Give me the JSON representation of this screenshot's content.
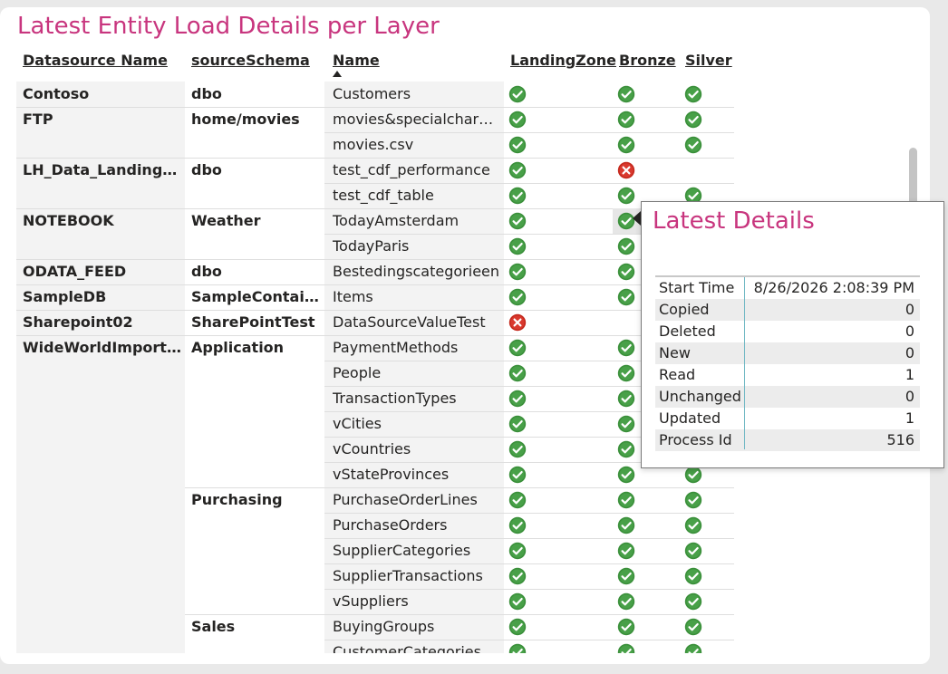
{
  "title": "Latest Entity Load Details per Layer",
  "columns": {
    "datasource": "Datasource Name",
    "schema": "sourceSchema",
    "name": "Name",
    "landing": "LandingZone",
    "bronze": "Bronze",
    "silver": "Silver"
  },
  "colors": {
    "accent": "#c8357e",
    "ok": "#3a8f3a",
    "fail": "#d9392e"
  },
  "rows": [
    {
      "ds": "Contoso",
      "schema": "dbo",
      "name": "Customers",
      "landing": "ok",
      "bronze": "ok",
      "silver": "ok"
    },
    {
      "ds": "FTP",
      "schema": "home/movies",
      "name": "movies&specialchara…",
      "landing": "ok",
      "bronze": "ok",
      "silver": "ok"
    },
    {
      "ds": "",
      "schema": "",
      "name": "movies.csv",
      "landing": "ok",
      "bronze": "ok",
      "silver": "ok"
    },
    {
      "ds": "LH_Data_Landingz…",
      "schema": "dbo",
      "name": "test_cdf_performance",
      "landing": "ok",
      "bronze": "fail",
      "silver": ""
    },
    {
      "ds": "",
      "schema": "",
      "name": "test_cdf_table",
      "landing": "ok",
      "bronze": "ok",
      "silver": "ok"
    },
    {
      "ds": "NOTEBOOK",
      "schema": "Weather",
      "name": "TodayAmsterdam",
      "landing": "ok",
      "bronze": "ok",
      "silver": "ok"
    },
    {
      "ds": "",
      "schema": "",
      "name": "TodayParis",
      "landing": "ok",
      "bronze": "ok",
      "silver": "ok"
    },
    {
      "ds": "ODATA_FEED",
      "schema": "dbo",
      "name": "Bestedingscategorieen",
      "landing": "ok",
      "bronze": "ok",
      "silver": "ok"
    },
    {
      "ds": "SampleDB",
      "schema": "SampleContainer",
      "name": "Items",
      "landing": "ok",
      "bronze": "ok",
      "silver": "ok"
    },
    {
      "ds": "Sharepoint02",
      "schema": "SharePointTest",
      "name": "DataSourceValueTest",
      "landing": "fail",
      "bronze": "",
      "silver": ""
    },
    {
      "ds": "WideWorldImporters",
      "schema": "Application",
      "name": "PaymentMethods",
      "landing": "ok",
      "bronze": "ok",
      "silver": "ok"
    },
    {
      "ds": "",
      "schema": "",
      "name": "People",
      "landing": "ok",
      "bronze": "ok",
      "silver": "ok"
    },
    {
      "ds": "",
      "schema": "",
      "name": "TransactionTypes",
      "landing": "ok",
      "bronze": "ok",
      "silver": "ok"
    },
    {
      "ds": "",
      "schema": "",
      "name": "vCities",
      "landing": "ok",
      "bronze": "ok",
      "silver": "ok"
    },
    {
      "ds": "",
      "schema": "",
      "name": "vCountries",
      "landing": "ok",
      "bronze": "ok",
      "silver": "ok"
    },
    {
      "ds": "",
      "schema": "",
      "name": "vStateProvinces",
      "landing": "ok",
      "bronze": "ok",
      "silver": "ok"
    },
    {
      "ds": "",
      "schema": "Purchasing",
      "name": "PurchaseOrderLines",
      "landing": "ok",
      "bronze": "ok",
      "silver": "ok"
    },
    {
      "ds": "",
      "schema": "",
      "name": "PurchaseOrders",
      "landing": "ok",
      "bronze": "ok",
      "silver": "ok"
    },
    {
      "ds": "",
      "schema": "",
      "name": "SupplierCategories",
      "landing": "ok",
      "bronze": "ok",
      "silver": "ok"
    },
    {
      "ds": "",
      "schema": "",
      "name": "SupplierTransactions",
      "landing": "ok",
      "bronze": "ok",
      "silver": "ok"
    },
    {
      "ds": "",
      "schema": "",
      "name": "vSuppliers",
      "landing": "ok",
      "bronze": "ok",
      "silver": "ok"
    },
    {
      "ds": "",
      "schema": "Sales",
      "name": "BuyingGroups",
      "landing": "ok",
      "bronze": "ok",
      "silver": "ok"
    },
    {
      "ds": "",
      "schema": "",
      "name": "CustomerCategories",
      "landing": "ok",
      "bronze": "ok",
      "silver": "ok"
    }
  ],
  "tooltip": {
    "title": "Latest Details",
    "rows": [
      {
        "k": "Start Time",
        "v": "8/26/2026 2:08:39 PM"
      },
      {
        "k": "Copied",
        "v": "0"
      },
      {
        "k": "Deleted",
        "v": "0"
      },
      {
        "k": "New",
        "v": "0"
      },
      {
        "k": "Read",
        "v": "1"
      },
      {
        "k": "Unchanged",
        "v": "0"
      },
      {
        "k": "Updated",
        "v": "1"
      },
      {
        "k": "Process Id",
        "v": "516"
      }
    ]
  }
}
